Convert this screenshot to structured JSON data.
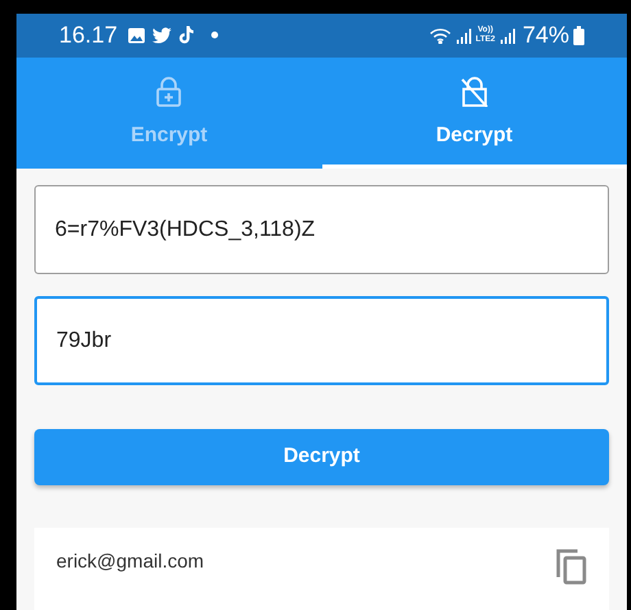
{
  "status_bar": {
    "time": "16.17",
    "network_top": "Vo))",
    "network_bottom": "LTE2",
    "battery": "74%"
  },
  "tabs": [
    {
      "label": "Encrypt",
      "kind": "plus",
      "selected": false
    },
    {
      "label": "Decrypt",
      "kind": "slash",
      "selected": true
    }
  ],
  "fields": [
    {
      "value": "6=r7%FV3(HDCS_3,118)Z",
      "focused": false
    },
    {
      "value": "79Jbr",
      "focused": true
    }
  ],
  "button": "Decrypt",
  "result": {
    "text": "erick@gmail.com"
  }
}
